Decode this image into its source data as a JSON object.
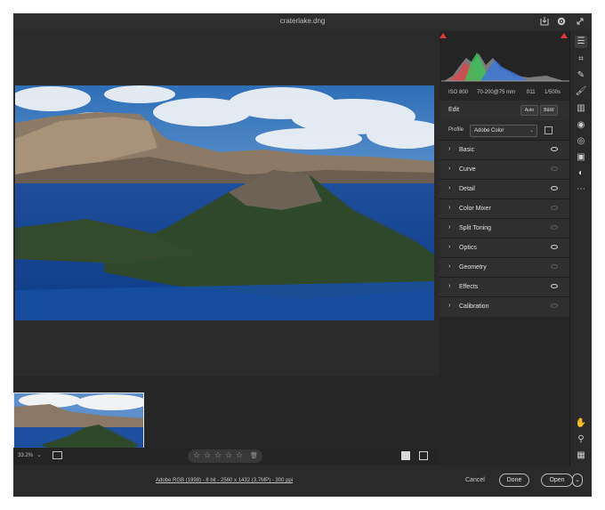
{
  "window": {
    "title": "craterlake.dng"
  },
  "histogram": {
    "exif": {
      "iso": "ISO 800",
      "lens": "70-200@75 mm",
      "aperture": "f/11",
      "shutter": "1/500s"
    }
  },
  "edit": {
    "title": "Edit",
    "auto_label": "Auto",
    "bw_label": "B&W",
    "profile_label": "Profile",
    "profile_value": "Adobe Color",
    "sections": [
      {
        "label": "Basic",
        "visible": true
      },
      {
        "label": "Curve",
        "visible": false
      },
      {
        "label": "Detail",
        "visible": true
      },
      {
        "label": "Color Mixer",
        "visible": false
      },
      {
        "label": "Split Toning",
        "visible": false
      },
      {
        "label": "Optics",
        "visible": true
      },
      {
        "label": "Geometry",
        "visible": false
      },
      {
        "label": "Effects",
        "visible": true
      },
      {
        "label": "Calibration",
        "visible": false
      }
    ]
  },
  "status": {
    "zoom": "33.2%"
  },
  "footer": {
    "workflow_link": "Adobe RGB (1998) - 8 bit - 2560 x 1432 (3.7MP) - 300 ppi",
    "cancel_label": "Cancel",
    "done_label": "Done",
    "open_label": "Open"
  },
  "colors": {
    "app_bg": "#1f1f1f",
    "panel_bg": "#2f2f2f",
    "accent_red": "#e03a3a"
  }
}
